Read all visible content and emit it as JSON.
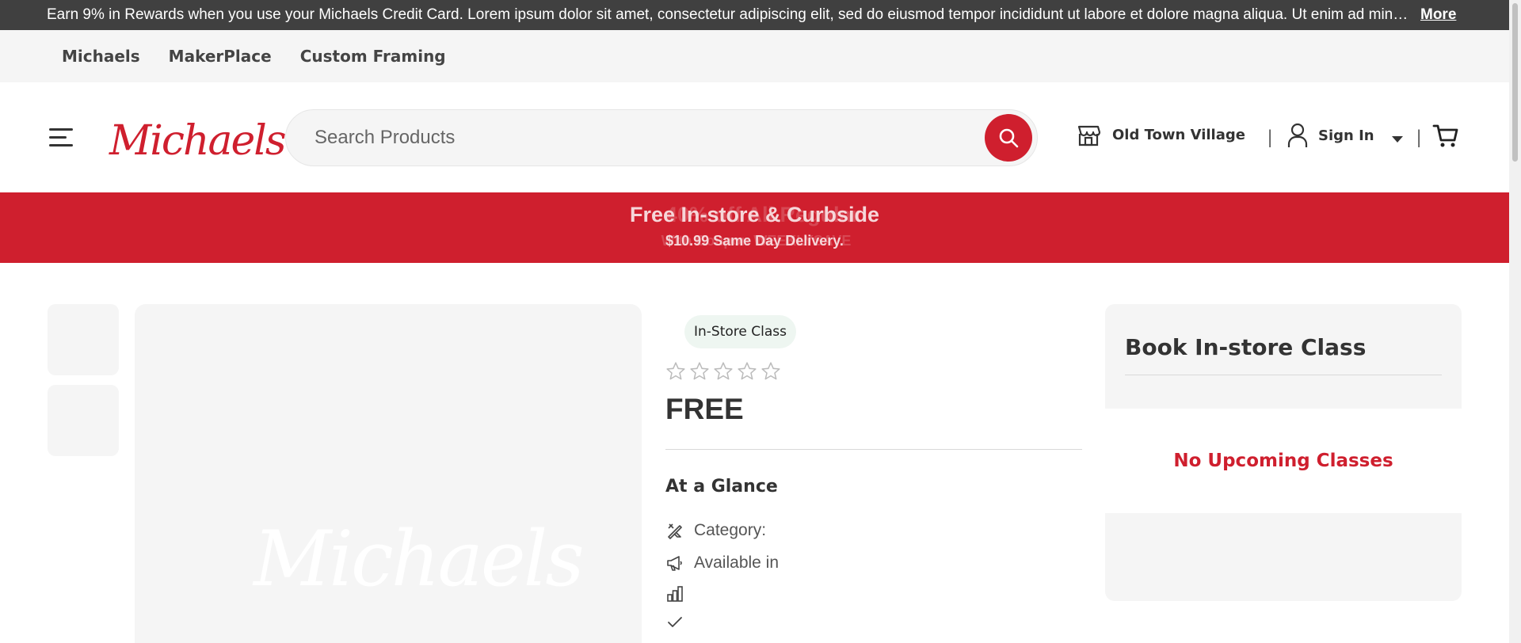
{
  "promo": {
    "text": "Earn 9% in Rewards when you use your Michaels Credit Card. Lorem ipsum dolor sit amet, consectetur adipiscing elit, sed do eiusmod tempor incididunt ut labore et dolore magna aliqua. Ut enim ad minim veniam",
    "more_label": "More"
  },
  "brand_nav": {
    "items": [
      "Michaels",
      "MakerPlace",
      "Custom Framing"
    ]
  },
  "header": {
    "logo_text": "Michaels",
    "search_placeholder": "Search Products",
    "store_label": "Old Town Village",
    "signin_label": "Sign In",
    "separator": "|"
  },
  "banner": {
    "title": "Free In-store & Curbside",
    "subtitle": "$10.99 Same Day Delivery.",
    "ghost_title": "40% off All Regular",
    "ghost_subtitle": "With Coupon WEEKLYSAVE"
  },
  "product": {
    "badge": "In-Store Class",
    "rating": 0,
    "rating_max": 5,
    "price": "FREE",
    "glance_heading": "At a Glance",
    "category_label": "Category:",
    "available_label": "Available in",
    "image_watermark": "Michaels"
  },
  "booking": {
    "title": "Book In-store Class",
    "empty_message": "No Upcoming Classes"
  },
  "colors": {
    "brand_red": "#cf1f2e",
    "promo_bg": "#404040",
    "nav_bg": "#f5f5f5"
  }
}
